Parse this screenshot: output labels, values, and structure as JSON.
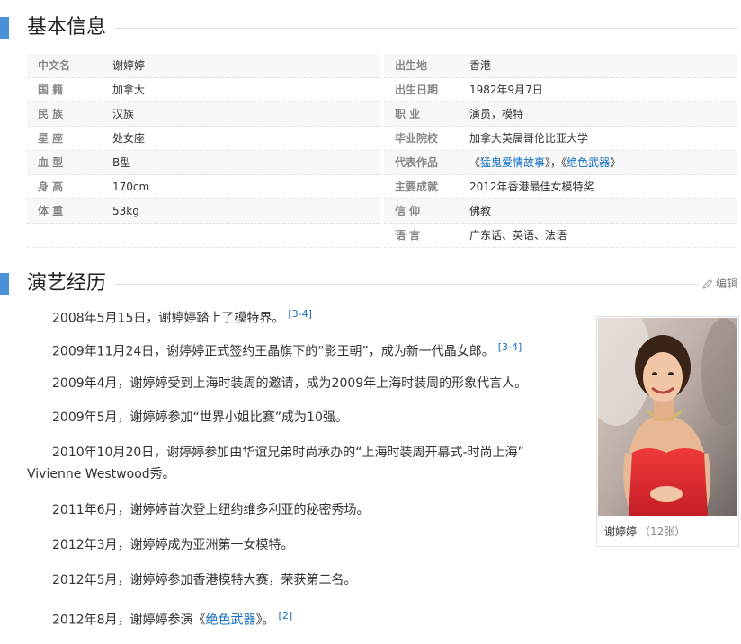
{
  "basic_info": {
    "title": "基本信息",
    "left": [
      {
        "label": "中文名",
        "value": "谢婷婷"
      },
      {
        "label": "国 籍",
        "value": "加拿大"
      },
      {
        "label": "民 族",
        "value": "汉族"
      },
      {
        "label": "星 座",
        "value": "处女座"
      },
      {
        "label": "血 型",
        "value": "B型"
      },
      {
        "label": "身 高",
        "value": "170cm"
      },
      {
        "label": "体 重",
        "value": "53kg"
      }
    ],
    "right": [
      {
        "label": "出生地",
        "value": "香港"
      },
      {
        "label": "出生日期",
        "value": "1982年9月7日"
      },
      {
        "label": "职 业",
        "value": "演员，模特"
      },
      {
        "label": "毕业院校",
        "value": "加拿大英属哥伦比亚大学"
      },
      {
        "label": "代表作品",
        "works": [
          "猛鬼爱情故事",
          "绝色武器"
        ],
        "sep": "，"
      },
      {
        "label": "主要成就",
        "value": "2012年香港最佳女模特奖"
      },
      {
        "label": "信 仰",
        "value": "佛教"
      },
      {
        "label": "语 言",
        "value": "广东话、英语、法语"
      }
    ]
  },
  "career": {
    "title": "演艺经历",
    "edit_label": "编辑",
    "paragraphs": [
      {
        "text": "2008年5月15日，谢婷婷踏上了模特界。",
        "ref": "[3-4]"
      },
      {
        "text": "2009年11月24日，谢婷婷正式签约王晶旗下的“影王朝”，成为新一代晶女郎。",
        "ref": "[3-4]"
      },
      {
        "text": "2009年4月，谢婷婷受到上海时装周的邀请，成为2009年上海时装周的形象代言人。"
      },
      {
        "text": "2009年5月，谢婷婷参加“世界小姐比赛”成为10强。"
      },
      {
        "text": "2010年10月20日，谢婷婷参加由华谊兄弟时尚承办的“上海时装周开幕式-时尚上海” Vivienne Westwood秀。"
      },
      {
        "text": "2011年6月，谢婷婷首次登上纽约维多利亚的秘密秀场。"
      },
      {
        "text": "2012年3月，谢婷婷成为亚洲第一女模特。"
      },
      {
        "text": "2012年5月，谢婷婷参加香港模特大赛，荣获第二名。"
      },
      {
        "text_before": "2012年8月，谢婷婷参演《",
        "link": "绝色武器",
        "text_after": "》。",
        "ref": "[2]"
      }
    ],
    "photo": {
      "caption": "谢婷婷",
      "count": "（12张）"
    }
  },
  "colors": {
    "accent": "#4a90d9",
    "link": "#136ec2"
  }
}
